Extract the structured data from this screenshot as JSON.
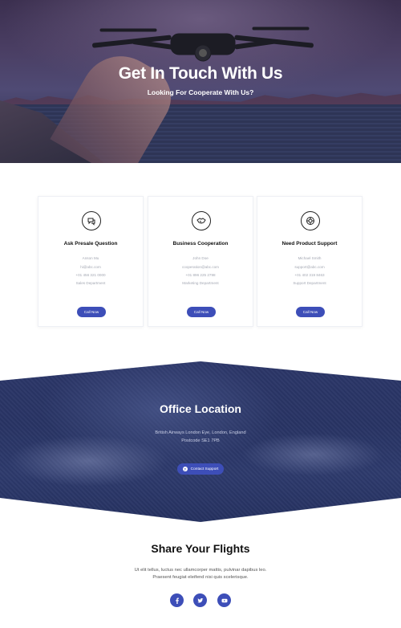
{
  "hero": {
    "title": "Get In Touch With Us",
    "subtitle": "Looking For Cooperate With Us?"
  },
  "cards": [
    {
      "icon": "chat-bubbles-icon",
      "title": "Ask Presale Question",
      "lines": [
        "Anson Mu",
        "hi@abc.com",
        "+01 456 321 0000",
        "Sales Department"
      ],
      "button": "Call Now"
    },
    {
      "icon": "handshake-icon",
      "title": "Business Cooperation",
      "lines": [
        "John Doe",
        "cooperation@abc.com",
        "+01 896 225 2798",
        "Marketing Department"
      ],
      "button": "Call Now"
    },
    {
      "icon": "lifebuoy-icon",
      "title": "Need Product Support",
      "lines": [
        "Michael Smith",
        "support@abc.com",
        "+01 402 319 8463",
        "Support Department"
      ],
      "button": "Call Now"
    }
  ],
  "office": {
    "title": "Office Location",
    "address_line1": "British Airways London Eye, London, England",
    "address_line2": "Postcode SE1 7PB",
    "button": "Contact Support",
    "button_icon": "question-circle-icon"
  },
  "share": {
    "title": "Share Your Flights",
    "text_line1": "Ut elit tellus, luctus nec ullamcorper mattis, pulvinar dapibus leo.",
    "text_line2": "Praesent feugiat eleifend nisi quis scelerisque.",
    "socials": [
      "facebook-icon",
      "twitter-icon",
      "youtube-icon"
    ]
  },
  "colors": {
    "accent": "#3d4eb8",
    "hero_overlay": "#4a3e63",
    "office_overlay": "#283464"
  }
}
